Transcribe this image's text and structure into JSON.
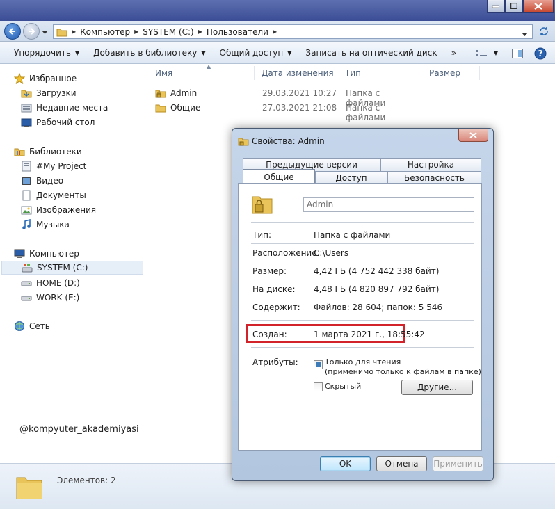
{
  "explorer": {
    "address": [
      "Компьютер",
      "SYSTEM (C:)",
      "Пользователи"
    ],
    "toolbar": {
      "organize": "Упорядочить",
      "add_to_library": "Добавить в библиотеку",
      "share": "Общий доступ",
      "burn": "Записать на оптический диск",
      "more": "»"
    },
    "sidebar": {
      "favorites": "Избранное",
      "downloads": "Загрузки",
      "recent": "Недавние места",
      "desktop": "Рабочий стол",
      "libraries": "Библиотеки",
      "my_project": "#My Project",
      "video": "Видео",
      "documents": "Документы",
      "images": "Изображения",
      "music": "Музыка",
      "computer": "Компьютер",
      "drive_c": "SYSTEM (C:)",
      "drive_d": "HOME (D:)",
      "drive_e": "WORK (E:)",
      "network": "Сеть"
    },
    "columns": {
      "name": "Имя",
      "date": "Дата изменения",
      "type": "Тип",
      "size": "Размер"
    },
    "files": [
      {
        "name": "Admin",
        "date": "29.03.2021 10:27",
        "type": "Папка с файлами"
      },
      {
        "name": "Общие",
        "date": "27.03.2021 21:08",
        "type": "Папка с файлами"
      }
    ],
    "status": "Элементов: 2",
    "watermark": "@kompyuter_akademiyasi"
  },
  "dialog": {
    "title": "Свойства: Admin",
    "tabs_back": [
      "Предыдущие версии",
      "Настройка"
    ],
    "tabs_front": [
      "Общие",
      "Доступ",
      "Безопасность"
    ],
    "name_value": "Admin",
    "props": {
      "type_label": "Тип:",
      "type_value": "Папка с файлами",
      "location_label": "Расположение:",
      "location_value": "C:\\Users",
      "size_label": "Размер:",
      "size_value": "4,42 ГБ (4 752 442 338 байт)",
      "ondisk_label": "На диске:",
      "ondisk_value": "4,48 ГБ (4 820 897 792 байт)",
      "contains_label": "Содержит:",
      "contains_value": "Файлов: 28 604; папок: 5 546",
      "created_label": "Создан:",
      "created_value": "1 марта 2021 г., 18:55:42",
      "attributes_label": "Атрибуты:",
      "readonly_line1": "Только для чтения",
      "readonly_line2": "(применимо только к файлам в папке)",
      "hidden": "Скрытый",
      "other_button": "Другие..."
    },
    "buttons": {
      "ok": "OK",
      "cancel": "Отмена",
      "apply": "Применить"
    }
  }
}
